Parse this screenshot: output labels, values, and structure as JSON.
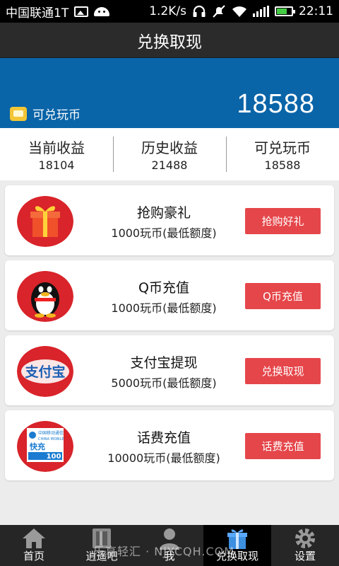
{
  "status_bar": {
    "carrier": "中国联通1T",
    "speed": "1.2K/s",
    "time": "22:11"
  },
  "title": "兑换取现",
  "balance": {
    "label": "可兑玩币",
    "amount": "18588"
  },
  "stats": [
    {
      "label": "当前收益",
      "value": "18104"
    },
    {
      "label": "历史收益",
      "value": "21488"
    },
    {
      "label": "可兑玩币",
      "value": "18588"
    }
  ],
  "cards": [
    {
      "icon": "gift-icon",
      "name": "抢购豪礼",
      "cost": "1000玩币(最低额度)",
      "button": "抢购好礼"
    },
    {
      "icon": "qq-penguin-icon",
      "name": "Q币充值",
      "cost": "1000玩币(最低额度)",
      "button": "Q币充值"
    },
    {
      "icon": "alipay-icon",
      "name": "支付宝提现",
      "cost": "5000玩币(最低额度)",
      "button": "兑换取现"
    },
    {
      "icon": "china-mobile-icon",
      "name": "话费充值",
      "cost": "10000玩币(最低额度)",
      "button": "话费充值"
    }
  ],
  "logo_text": {
    "alipay": "支付宝",
    "mobile_top": "中国移动通信",
    "mobile_en": "CHINA MOBILE",
    "mobile_brand": "快充",
    "mobile_value": "100"
  },
  "nav": [
    {
      "icon": "home-icon",
      "label": "首页"
    },
    {
      "icon": "book-icon",
      "label": "逍遥吧"
    },
    {
      "icon": "person-icon",
      "label": "我"
    },
    {
      "icon": "gift-box-icon",
      "label": "兑换取现",
      "active": true
    },
    {
      "icon": "gear-icon",
      "label": "设置"
    }
  ],
  "watermark": "乐享轻汇 · NJYCQH.COM",
  "colors": {
    "header_blue": "#0a64a8",
    "button_red": "#e5464a",
    "titlebar": "#2b2b2b"
  }
}
